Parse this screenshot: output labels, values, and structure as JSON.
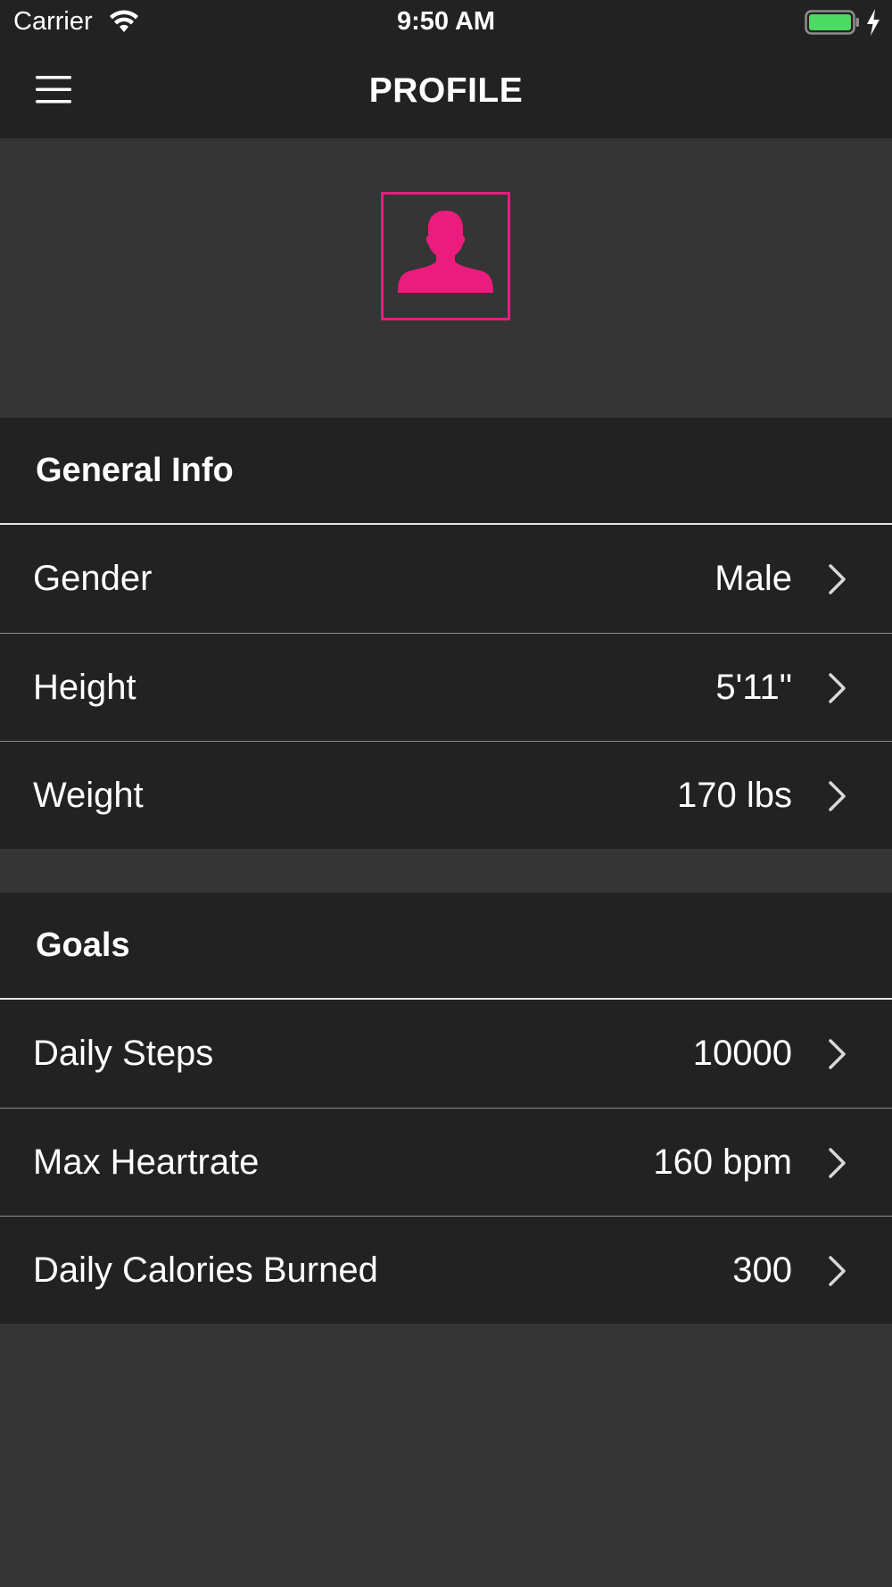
{
  "status_bar": {
    "carrier": "Carrier",
    "time": "9:50 AM",
    "icons": [
      "wifi-icon",
      "battery-icon",
      "charging-bolt-icon"
    ],
    "battery_color": "#4cd964"
  },
  "nav": {
    "title": "PROFILE",
    "menu_icon": "hamburger-menu-icon"
  },
  "avatar": {
    "icon": "user-silhouette-icon",
    "accent_color": "#ec1c7f"
  },
  "general_info": {
    "title": "General Info",
    "rows": [
      {
        "label": "Gender",
        "value": "Male"
      },
      {
        "label": "Height",
        "value": "5'11\""
      },
      {
        "label": "Weight",
        "value": "170 lbs"
      }
    ]
  },
  "goals": {
    "title": "Goals",
    "rows": [
      {
        "label": "Daily Steps",
        "value": "10000"
      },
      {
        "label": "Max Heartrate",
        "value": "160 bpm"
      },
      {
        "label": "Daily Calories Burned",
        "value": "300"
      }
    ]
  },
  "colors": {
    "background": "#353535",
    "section_background": "#222222",
    "text": "#ffffff",
    "accent": "#ec1c7f"
  }
}
